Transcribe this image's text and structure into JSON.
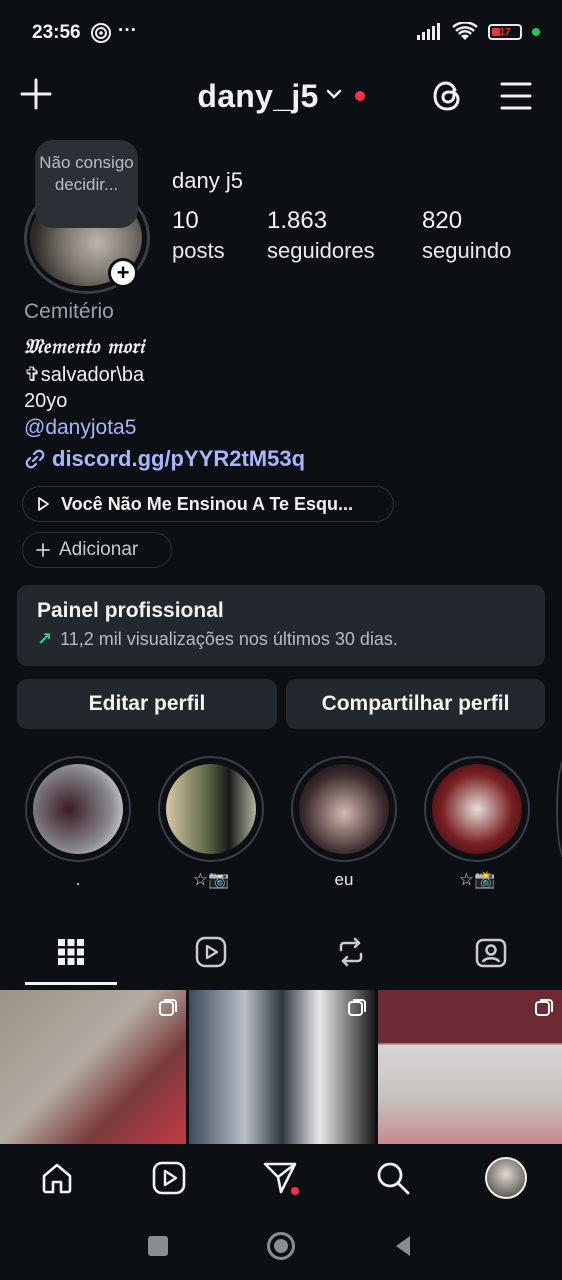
{
  "status_bar": {
    "time": "23:56",
    "extra": "···",
    "battery_level": "17",
    "colors": {
      "battery_low": "#e53935",
      "active_dot": "#22c55e"
    }
  },
  "header": {
    "username": "dany_j5",
    "icons": [
      "plus-icon",
      "chevron-down-icon",
      "threads-icon",
      "menu-icon"
    ],
    "notification_dot_color": "#ff2f4a"
  },
  "profile": {
    "note": "Não consigo decidir...",
    "display_name": "dany j5",
    "stats": [
      {
        "value": "10",
        "label": "posts"
      },
      {
        "value": "1.863",
        "label": "seguidores"
      },
      {
        "value": "820",
        "label": "seguindo"
      }
    ],
    "category": "Cemitério",
    "bio": [
      "𝔐𝔢𝔪𝔢𝔫𝔱𝔬 𝔪𝔬𝔯𝔦",
      "✞salvador\\ba",
      " 20yo"
    ],
    "mention": "@danyjota5",
    "link": "discord.gg/pYYR2tM53q",
    "music": "Você Não Me Ensinou A Te Esqu...",
    "add_label": "Adicionar"
  },
  "professional_panel": {
    "title": "Painel profissional",
    "subtitle": "11,2 mil visualizações nos últimos 30 dias."
  },
  "buttons": {
    "edit": "Editar perfil",
    "share": "Compartilhar perfil"
  },
  "highlights": [
    {
      "label": "."
    },
    {
      "label": "☆📷"
    },
    {
      "label": "eu"
    },
    {
      "label": "☆📸"
    }
  ],
  "tabs": [
    "grid-icon",
    "reels-icon",
    "reposts-icon",
    "tagged-icon"
  ],
  "bottom_nav": [
    "home-icon",
    "reels-icon",
    "activity-icon",
    "search-icon",
    "profile-avatar"
  ],
  "accent_link_color": "#a9b6ff"
}
